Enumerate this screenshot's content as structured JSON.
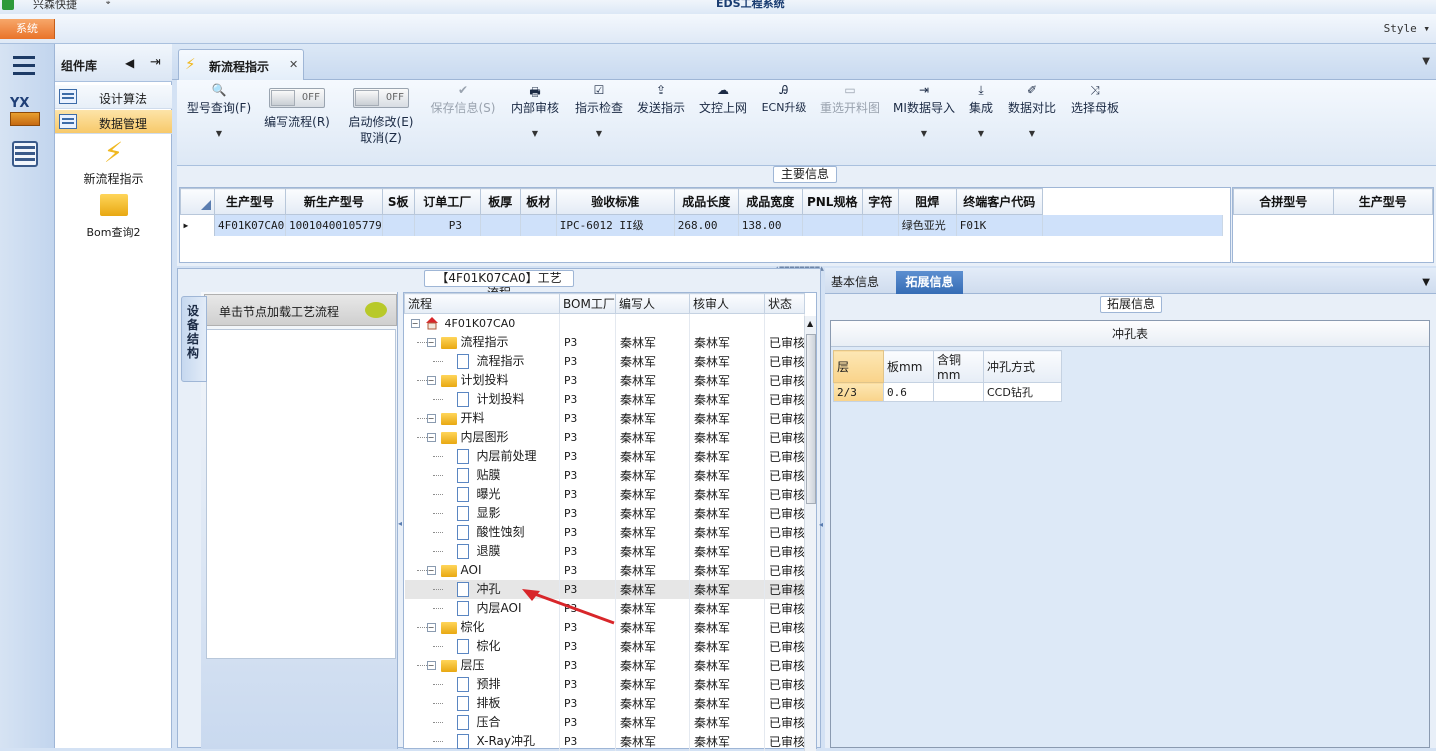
{
  "titlebar": {
    "app_name": "兴森快捷",
    "system_name": "EDS工程系统"
  },
  "menubar": {
    "system_menu": "系统",
    "style_menu": "Style ▾"
  },
  "left_strip": {
    "badge": "YX"
  },
  "library": {
    "title": "组件库",
    "items": [
      {
        "label": "设计算法"
      },
      {
        "label": "数据管理"
      }
    ],
    "big_items": [
      {
        "label": "新流程指示"
      },
      {
        "label": "Bom查询2"
      }
    ]
  },
  "tabs": [
    {
      "label": "新流程指示"
    }
  ],
  "ribbon": {
    "buttons": [
      {
        "label": "型号查询(F)",
        "icon": "🔍"
      },
      {
        "label": "编写流程(R)",
        "toggle": "OFF"
      },
      {
        "label": "启动修改(E)",
        "sub": "取消(Z)",
        "toggle": "OFF"
      },
      {
        "label": "保存信息(S)",
        "icon": "✔"
      },
      {
        "label": "内部审核",
        "icon": "🖶"
      },
      {
        "label": "指示检查",
        "icon": "☑"
      },
      {
        "label": "发送指示",
        "icon": "⇪"
      },
      {
        "label": "文控上网",
        "icon": "☁"
      },
      {
        "label": "ECN升级",
        "icon": "Ꭿ"
      },
      {
        "label": "重选开料图",
        "icon": "▭"
      },
      {
        "label": "MI数据导入",
        "icon": "⇥"
      },
      {
        "label": "集成",
        "icon": "⤓"
      },
      {
        "label": "数据对比",
        "icon": "✐"
      },
      {
        "label": "选择母板",
        "icon": "⤨"
      }
    ]
  },
  "main_info": {
    "group_label": "主要信息",
    "columns": [
      "生产型号",
      "新生产型号",
      "S板",
      "订单工厂",
      "板厚",
      "板材",
      "验收标准",
      "成品长度",
      "成品宽度",
      "PNL规格",
      "字符",
      "阻焊",
      "终端客户代码"
    ],
    "rows": [
      [
        "4F01K07CA0",
        "10010400105779",
        "",
        "P3",
        "",
        "",
        "IPC-6012 II级",
        "268.00",
        "138.00",
        "",
        "",
        "绿色亚光",
        "F01K"
      ]
    ],
    "side_columns": [
      "合拼型号",
      "生产型号"
    ]
  },
  "process": {
    "group_label": "【4F01K07CA0】工艺流程",
    "vertical_tab": "设备结构",
    "hint": "单击节点加载工艺流程",
    "columns": [
      "流程",
      "BOM工厂",
      "编写人",
      "核审人",
      "状态"
    ],
    "rows": [
      {
        "name": "4F01K07CA0",
        "factory": "",
        "writer": "",
        "checker": "",
        "status": ""
      },
      {
        "name": "流程指示",
        "factory": "P3",
        "writer": "秦林军",
        "checker": "秦林军",
        "status": "已审核"
      },
      {
        "name": "流程指示",
        "factory": "P3",
        "writer": "秦林军",
        "checker": "秦林军",
        "status": "已审核"
      },
      {
        "name": "计划投料",
        "factory": "P3",
        "writer": "秦林军",
        "checker": "秦林军",
        "status": "已审核"
      },
      {
        "name": "计划投料",
        "factory": "P3",
        "writer": "秦林军",
        "checker": "秦林军",
        "status": "已审核"
      },
      {
        "name": "开料",
        "factory": "P3",
        "writer": "秦林军",
        "checker": "秦林军",
        "status": "已审核"
      },
      {
        "name": "内层图形",
        "factory": "P3",
        "writer": "秦林军",
        "checker": "秦林军",
        "status": "已审核"
      },
      {
        "name": "内层前处理",
        "factory": "P3",
        "writer": "秦林军",
        "checker": "秦林军",
        "status": "已审核"
      },
      {
        "name": "贴膜",
        "factory": "P3",
        "writer": "秦林军",
        "checker": "秦林军",
        "status": "已审核"
      },
      {
        "name": "曝光",
        "factory": "P3",
        "writer": "秦林军",
        "checker": "秦林军",
        "status": "已审核"
      },
      {
        "name": "显影",
        "factory": "P3",
        "writer": "秦林军",
        "checker": "秦林军",
        "status": "已审核"
      },
      {
        "name": "酸性蚀刻",
        "factory": "P3",
        "writer": "秦林军",
        "checker": "秦林军",
        "status": "已审核"
      },
      {
        "name": "退膜",
        "factory": "P3",
        "writer": "秦林军",
        "checker": "秦林军",
        "status": "已审核"
      },
      {
        "name": "AOI",
        "factory": "P3",
        "writer": "秦林军",
        "checker": "秦林军",
        "status": "已审核"
      },
      {
        "name": "冲孔",
        "factory": "P3",
        "writer": "秦林军",
        "checker": "秦林军",
        "status": "已审核"
      },
      {
        "name": "内层AOI",
        "factory": "P3",
        "writer": "秦林军",
        "checker": "秦林军",
        "status": "已审核"
      },
      {
        "name": "棕化",
        "factory": "P3",
        "writer": "秦林军",
        "checker": "秦林军",
        "status": "已审核"
      },
      {
        "name": "棕化",
        "factory": "P3",
        "writer": "秦林军",
        "checker": "秦林军",
        "status": "已审核"
      },
      {
        "name": "层压",
        "factory": "P3",
        "writer": "秦林军",
        "checker": "秦林军",
        "status": "已审核"
      },
      {
        "name": "预排",
        "factory": "P3",
        "writer": "秦林军",
        "checker": "秦林军",
        "status": "已审核"
      },
      {
        "name": "排板",
        "factory": "P3",
        "writer": "秦林军",
        "checker": "秦林军",
        "status": "已审核"
      },
      {
        "name": "压合",
        "factory": "P3",
        "writer": "秦林军",
        "checker": "秦林军",
        "status": "已审核"
      },
      {
        "name": "X-Ray冲孔",
        "factory": "P3",
        "writer": "秦林军",
        "checker": "秦林军",
        "status": "已审核"
      }
    ]
  },
  "detail": {
    "tabs": [
      "基本信息",
      "拓展信息"
    ],
    "group_label": "拓展信息",
    "table_title": "冲孔表",
    "columns": [
      "层",
      "板mm",
      "含铜mm",
      "冲孔方式"
    ],
    "rows": [
      [
        "2/3",
        "0.6",
        "",
        "CCD钻孔"
      ]
    ]
  }
}
